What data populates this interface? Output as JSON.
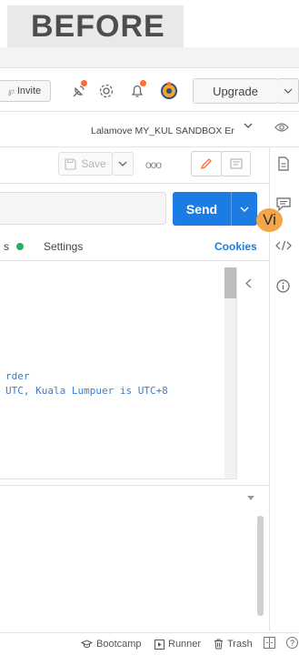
{
  "banner": {
    "text": "BEFORE"
  },
  "header": {
    "invite_label": "Invite",
    "upgrade_label": "Upgrade"
  },
  "environment": {
    "selected": "Lalamove MY_KUL SANDBOX Er"
  },
  "toolbar": {
    "save_label": "Save",
    "more_label": "ooo"
  },
  "request": {
    "send_label": "Send",
    "tabs": {
      "partial": "s",
      "settings": "Settings",
      "cookies": "Cookies"
    }
  },
  "editor": {
    "lines": [
      "rder",
      "UTC, Kuala Lumpuer is UTC+8"
    ]
  },
  "user": {
    "avatar_initials": "Vi"
  },
  "statusbar": {
    "bootcamp": "Bootcamp",
    "runner": "Runner",
    "trash": "Trash",
    "help": "?"
  },
  "colors": {
    "accent": "#1b7ce4",
    "brand_orange": "#ff6c37",
    "success_dot": "#27ae60",
    "avatar_bg": "#f4a74a",
    "code_text": "#3f7cc8"
  },
  "icons": [
    "satellite-icon",
    "gear-icon",
    "bell-icon",
    "postman-logo-icon",
    "eye-icon",
    "document-icon",
    "comment-icon",
    "code-icon",
    "info-icon",
    "pencil-icon",
    "chevron-down-icon",
    "chevron-left-icon",
    "graduation-cap-icon",
    "runner-icon",
    "trash-icon",
    "layout-icon",
    "help-icon"
  ]
}
